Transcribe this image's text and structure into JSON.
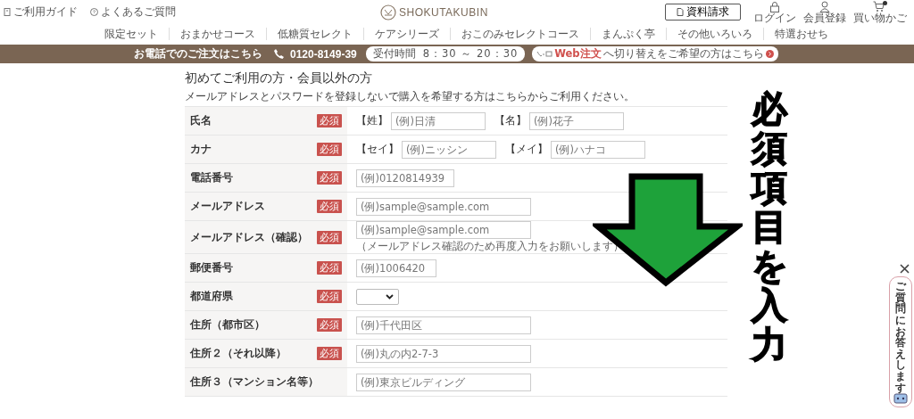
{
  "top_links": [
    {
      "label": "ご利用ガイド",
      "kind": "guide"
    },
    {
      "label": "よくあるご質問",
      "kind": "faq"
    }
  ],
  "logo": "SHOKUTAKUBIN",
  "request_button": "資料請求",
  "account_links": [
    {
      "label": "ログイン",
      "kind": "login"
    },
    {
      "label": "会員登録",
      "kind": "member"
    },
    {
      "label": "買い物かご",
      "kind": "cart"
    }
  ],
  "nav": [
    "限定セット",
    "おまかせコース",
    "低糖質セレクト",
    "ケアシリーズ",
    "おこのみセレクトコース",
    "まんぷく亭",
    "その他いろいろ",
    "特選おせち"
  ],
  "banner": {
    "lead": "お電話でのご注文はこちら",
    "phone": "0120-8149-39",
    "hours_label": "受付時間",
    "hours": "8：30 ～ 20：30",
    "web_highlight": "Web注文",
    "web_rest": "へ切り替えをご希望の方はこちら"
  },
  "form": {
    "title": "初めてご利用の方・会員以外の方",
    "note": "メールアドレスとパスワードを登録しないで購入を希望する方はこちらからご利用ください。",
    "rows": [
      {
        "label": "氏名",
        "badge": "必須",
        "kind": "pair",
        "fields": [
          {
            "prefix": "【姓】",
            "placeholder": "(例)日清",
            "kind": "half"
          },
          {
            "prefix": "【名】",
            "placeholder": "(例)花子",
            "kind": "half"
          }
        ]
      },
      {
        "label": "カナ",
        "badge": "必須",
        "kind": "pair",
        "fields": [
          {
            "prefix": "【セイ】",
            "placeholder": "(例)ニッシン",
            "kind": "half"
          },
          {
            "prefix": "【メイ】",
            "placeholder": "(例)ハナコ",
            "kind": "half"
          }
        ]
      },
      {
        "label": "電話番号",
        "badge": "必須",
        "kind": "input",
        "fields": [
          {
            "placeholder": "(例)0120814939",
            "kind": "tel"
          }
        ]
      },
      {
        "label": "メールアドレス",
        "badge": "必須",
        "kind": "input",
        "fields": [
          {
            "placeholder": "(例)sample@sample.com",
            "kind": "long"
          }
        ]
      },
      {
        "label": "メールアドレス（確認）",
        "badge": "必須",
        "kind": "input",
        "fields": [
          {
            "placeholder": "(例)sample@sample.com",
            "kind": "long"
          }
        ],
        "hint": "（メールアドレス確認のため再度入力をお願いします）"
      },
      {
        "label": "郵便番号",
        "badge": "必須",
        "kind": "input",
        "fields": [
          {
            "placeholder": "(例)1006420",
            "kind": "zip"
          }
        ]
      },
      {
        "label": "都道府県",
        "badge": "必須",
        "kind": "select"
      },
      {
        "label": "住所（都市区）",
        "badge": "必須",
        "kind": "input",
        "fields": [
          {
            "placeholder": "(例)千代田区",
            "kind": "long"
          }
        ]
      },
      {
        "label": "住所２（それ以降）",
        "badge": "必須",
        "kind": "input",
        "fields": [
          {
            "placeholder": "(例)丸の内2-7-3",
            "kind": "long"
          }
        ]
      },
      {
        "label": "住所３（マンション名等）",
        "kind": "input",
        "fields": [
          {
            "placeholder": "(例)東京ビルディング",
            "kind": "long"
          }
        ]
      }
    ]
  },
  "callout": "必須項目を入力",
  "chat_widget": "ご質問にお答えします"
}
